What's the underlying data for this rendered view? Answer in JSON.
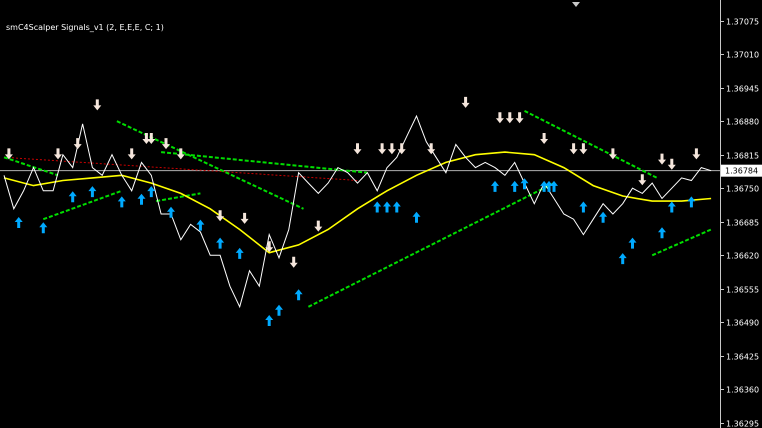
{
  "chart_data": {
    "type": "line",
    "title": "smC4Scalper Signals_v1 (2, E,E,E, C; 1)",
    "y_tick_labels": [
      "1.37075",
      "1.37010",
      "1.36945",
      "1.36880",
      "1.36815",
      "1.36750",
      "1.36685",
      "1.36620",
      "1.36555",
      "1.36490",
      "1.36425",
      "1.36360",
      "1.36295"
    ],
    "y_ticks": [
      1.37075,
      1.3701,
      1.36945,
      1.3688,
      1.36815,
      1.3675,
      1.36685,
      1.3662,
      1.36555,
      1.3649,
      1.36425,
      1.3636,
      1.36295
    ],
    "ylim": [
      1.36285,
      1.37115
    ],
    "current_price": 1.36784,
    "current_price_label": "1.36784",
    "x_bars": 145,
    "grid": false,
    "colors": {
      "background": "#000000",
      "price": "#ffffff",
      "ma": "#ffff00",
      "upper_band": "#00dd00",
      "lower_band": "#00dd00",
      "ma_dashed": "#cc0000",
      "buy_arrow": "#00aaff",
      "sell_arrow": "#f5e6dc"
    },
    "series": [
      {
        "kind": "price",
        "x": [
          0,
          2,
          4,
          6,
          8,
          10,
          12,
          14,
          16,
          18,
          20,
          22,
          24,
          26,
          28,
          30,
          32,
          34,
          36,
          38,
          40,
          42,
          44,
          46,
          48,
          50,
          52,
          54,
          56,
          58,
          60,
          62,
          64,
          66,
          68,
          70,
          72,
          74,
          76,
          78,
          80,
          82,
          84,
          86,
          88,
          90,
          92,
          94,
          96,
          98,
          100,
          102,
          104,
          106,
          108,
          110,
          112,
          114,
          116,
          118,
          120,
          122,
          124,
          126,
          128,
          130,
          132,
          134,
          136,
          138,
          140,
          142,
          144
        ],
        "y": [
          1.36775,
          1.3671,
          1.36745,
          1.3679,
          1.36745,
          1.36745,
          1.36815,
          1.3679,
          1.36875,
          1.3679,
          1.36775,
          1.36815,
          1.36775,
          1.36745,
          1.368,
          1.36775,
          1.367,
          1.367,
          1.3665,
          1.3668,
          1.36665,
          1.3662,
          1.3662,
          1.3656,
          1.3652,
          1.3659,
          1.3656,
          1.3666,
          1.36615,
          1.3667,
          1.3678,
          1.3676,
          1.3674,
          1.3676,
          1.3679,
          1.3678,
          1.3676,
          1.3678,
          1.36745,
          1.3679,
          1.3681,
          1.3685,
          1.3689,
          1.3684,
          1.3681,
          1.3678,
          1.36835,
          1.3681,
          1.3679,
          1.368,
          1.3679,
          1.36775,
          1.368,
          1.3676,
          1.3672,
          1.3676,
          1.3673,
          1.367,
          1.3669,
          1.3666,
          1.3669,
          1.3672,
          1.367,
          1.3672,
          1.3675,
          1.3674,
          1.3676,
          1.3673,
          1.3675,
          1.3677,
          1.36765,
          1.3679,
          1.36784
        ]
      },
      {
        "kind": "ma",
        "x": [
          0,
          6,
          12,
          18,
          24,
          30,
          36,
          42,
          48,
          54,
          60,
          66,
          72,
          78,
          84,
          90,
          96,
          102,
          108,
          114,
          120,
          126,
          132,
          138,
          144
        ],
        "y": [
          1.3677,
          1.36755,
          1.36765,
          1.3677,
          1.36775,
          1.3676,
          1.3674,
          1.3671,
          1.3667,
          1.36625,
          1.3664,
          1.3667,
          1.3671,
          1.36745,
          1.36775,
          1.368,
          1.36815,
          1.3682,
          1.36815,
          1.3679,
          1.36755,
          1.36735,
          1.36725,
          1.36725,
          1.3673
        ]
      },
      {
        "kind": "upper_band",
        "segments": [
          {
            "x": [
              0,
              11
            ],
            "y": [
              1.3681,
              1.36775
            ]
          },
          {
            "x": [
              23,
              61
            ],
            "y": [
              1.3688,
              1.3671
            ]
          },
          {
            "x": [
              32,
              74
            ],
            "y": [
              1.3682,
              1.3678
            ]
          },
          {
            "x": [
              106,
              133
            ],
            "y": [
              1.369,
              1.3677
            ]
          }
        ]
      },
      {
        "kind": "lower_band",
        "segments": [
          {
            "x": [
              8,
              24
            ],
            "y": [
              1.3669,
              1.36745
            ]
          },
          {
            "x": [
              31,
              40
            ],
            "y": [
              1.36725,
              1.3674
            ]
          },
          {
            "x": [
              62,
              112
            ],
            "y": [
              1.3652,
              1.3676
            ]
          },
          {
            "x": [
              132,
              144
            ],
            "y": [
              1.3662,
              1.3667
            ]
          }
        ]
      }
    ],
    "buy_signals": {
      "x": [
        3,
        8,
        14,
        18,
        24,
        28,
        30,
        34,
        40,
        44,
        48,
        54,
        56,
        60,
        76,
        78,
        80,
        84,
        100,
        104,
        106,
        110,
        111,
        112,
        118,
        122,
        126,
        128,
        134,
        136,
        140
      ],
      "y": [
        1.367,
        1.3669,
        1.3675,
        1.3676,
        1.3674,
        1.36745,
        1.3676,
        1.3672,
        1.36695,
        1.3666,
        1.3664,
        1.3651,
        1.3653,
        1.3656,
        1.3673,
        1.3673,
        1.3673,
        1.3671,
        1.3677,
        1.3677,
        1.36775,
        1.3677,
        1.3677,
        1.3677,
        1.3673,
        1.3671,
        1.3663,
        1.3666,
        1.3668,
        1.3673,
        1.3674
      ]
    },
    "sell_signals": {
      "x": [
        1,
        11,
        15,
        19,
        26,
        29,
        30,
        33,
        36,
        44,
        49,
        54,
        59,
        64,
        72,
        77,
        79,
        81,
        87,
        94,
        101,
        103,
        105,
        110,
        116,
        118,
        124,
        130,
        134,
        136,
        141
      ],
      "y": [
        1.368,
        1.368,
        1.3682,
        1.36895,
        1.368,
        1.3683,
        1.3683,
        1.3682,
        1.368,
        1.3668,
        1.36675,
        1.3662,
        1.3659,
        1.3666,
        1.3681,
        1.3681,
        1.3681,
        1.3681,
        1.3681,
        1.369,
        1.3687,
        1.3687,
        1.3687,
        1.3683,
        1.3681,
        1.3681,
        1.368,
        1.3675,
        1.3679,
        1.3678,
        1.368
      ]
    }
  }
}
